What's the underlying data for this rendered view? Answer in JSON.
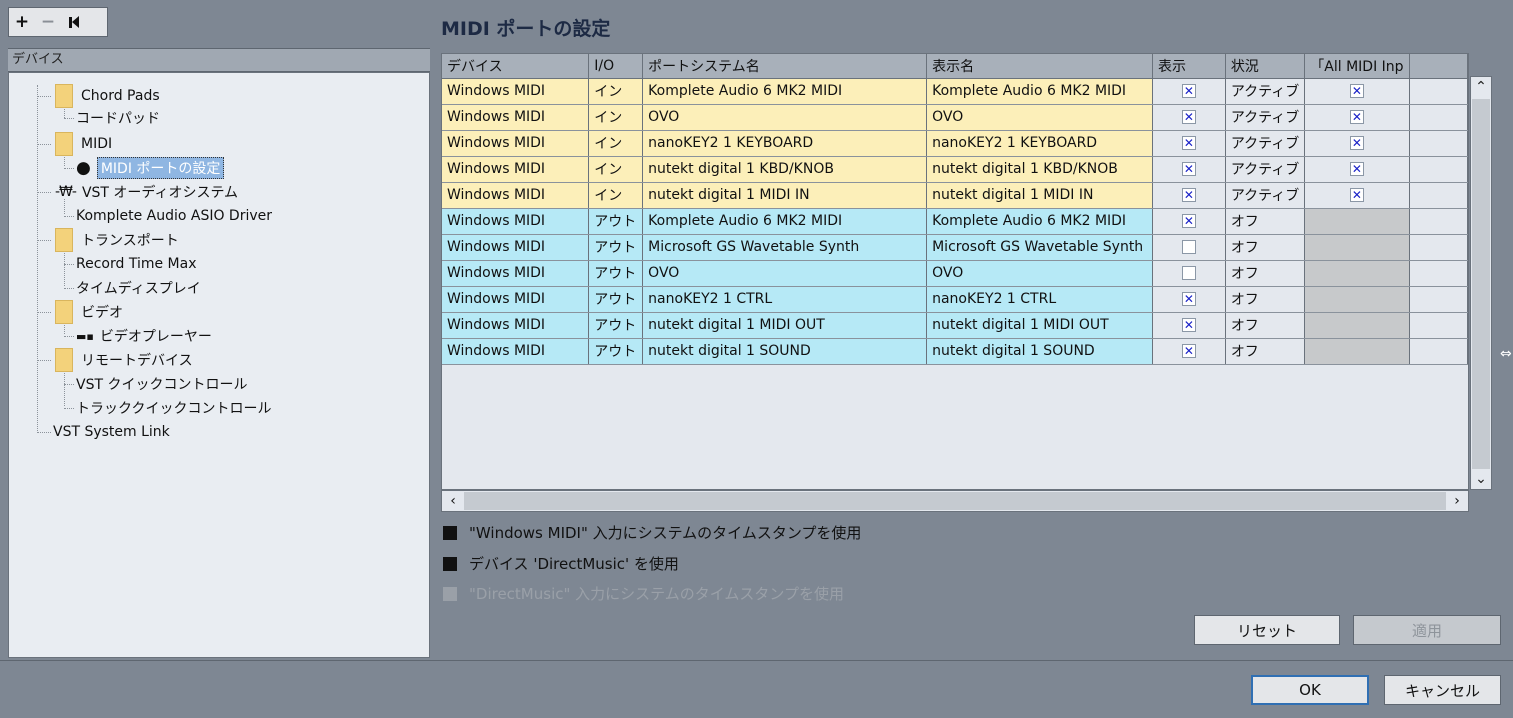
{
  "toolbar": {
    "add": "+",
    "remove": "−"
  },
  "left": {
    "header": "デバイス",
    "tree": [
      {
        "label": "Chord Pads",
        "type": "folder"
      },
      {
        "label": "コードパッド",
        "type": "leaf"
      },
      {
        "label": "MIDI",
        "type": "folder"
      },
      {
        "label": "MIDI ポートの設定",
        "type": "selected"
      },
      {
        "label": "VST オーディオシステム",
        "type": "vst"
      },
      {
        "label": "Komplete Audio ASIO Driver",
        "type": "leaf"
      },
      {
        "label": "トランスポート",
        "type": "folder"
      },
      {
        "label": "Record Time Max",
        "type": "leaf"
      },
      {
        "label": "タイムディスプレイ",
        "type": "leaf"
      },
      {
        "label": "ビデオ",
        "type": "folder"
      },
      {
        "label": "ビデオプレーヤー",
        "type": "video"
      },
      {
        "label": "リモートデバイス",
        "type": "folder"
      },
      {
        "label": "VST クイックコントロール",
        "type": "leaf"
      },
      {
        "label": "トラッククイックコントロール",
        "type": "leaf"
      },
      {
        "label": "VST System Link",
        "type": "root"
      }
    ]
  },
  "main": {
    "title": "MIDI ポートの設定",
    "columns": [
      "デバイス",
      "I/O",
      "ポートシステム名",
      "表示名",
      "表示",
      "状況",
      "「All MIDI Inp"
    ],
    "rows": [
      {
        "device": "Windows MIDI",
        "io": "イン",
        "port": "Komplete Audio 6 MK2 MIDI",
        "display": "Komplete Audio 6 MK2 MIDI",
        "visible": true,
        "status": "アクティブ",
        "all_midi": true
      },
      {
        "device": "Windows MIDI",
        "io": "イン",
        "port": "OVO",
        "display": "OVO",
        "visible": true,
        "status": "アクティブ",
        "all_midi": true
      },
      {
        "device": "Windows MIDI",
        "io": "イン",
        "port": "nanoKEY2 1 KEYBOARD",
        "display": "nanoKEY2 1 KEYBOARD",
        "visible": true,
        "status": "アクティブ",
        "all_midi": true
      },
      {
        "device": "Windows MIDI",
        "io": "イン",
        "port": "nutekt digital 1 KBD/KNOB",
        "display": "nutekt digital 1 KBD/KNOB",
        "visible": true,
        "status": "アクティブ",
        "all_midi": true
      },
      {
        "device": "Windows MIDI",
        "io": "イン",
        "port": "nutekt digital 1 MIDI IN",
        "display": "nutekt digital 1 MIDI IN",
        "visible": true,
        "status": "アクティブ",
        "all_midi": true
      },
      {
        "device": "Windows MIDI",
        "io": "アウト",
        "port": "Komplete Audio 6 MK2 MIDI",
        "display": "Komplete Audio 6 MK2 MIDI",
        "visible": true,
        "status": "オフ",
        "all_midi": null
      },
      {
        "device": "Windows MIDI",
        "io": "アウト",
        "port": "Microsoft GS Wavetable Synth",
        "display": "Microsoft GS Wavetable Synth",
        "visible": false,
        "status": "オフ",
        "all_midi": null
      },
      {
        "device": "Windows MIDI",
        "io": "アウト",
        "port": "OVO",
        "display": "OVO",
        "visible": false,
        "status": "オフ",
        "all_midi": null
      },
      {
        "device": "Windows MIDI",
        "io": "アウト",
        "port": "nanoKEY2 1 CTRL",
        "display": "nanoKEY2 1 CTRL",
        "visible": true,
        "status": "オフ",
        "all_midi": null
      },
      {
        "device": "Windows MIDI",
        "io": "アウト",
        "port": "nutekt digital 1 MIDI OUT",
        "display": "nutekt digital 1 MIDI OUT",
        "visible": true,
        "status": "オフ",
        "all_midi": null
      },
      {
        "device": "Windows MIDI",
        "io": "アウト",
        "port": "nutekt digital 1 SOUND",
        "display": "nutekt digital 1 SOUND",
        "visible": true,
        "status": "オフ",
        "all_midi": null
      }
    ],
    "options": [
      {
        "label": "\"Windows MIDI\" 入力にシステムのタイムスタンプを使用",
        "enabled": true
      },
      {
        "label": "デバイス 'DirectMusic' を使用",
        "enabled": true
      },
      {
        "label": "\"DirectMusic\" 入力にシステムのタイムスタンプを使用",
        "enabled": false
      }
    ],
    "reset_label": "リセット",
    "apply_label": "適用"
  },
  "footer": {
    "ok_label": "OK",
    "cancel_label": "キャンセル"
  },
  "colors": {
    "in_row": "#fcefb9",
    "out_row": "#b6e9f6",
    "selected": "#8fb6e2",
    "check": "#1a22c8"
  }
}
